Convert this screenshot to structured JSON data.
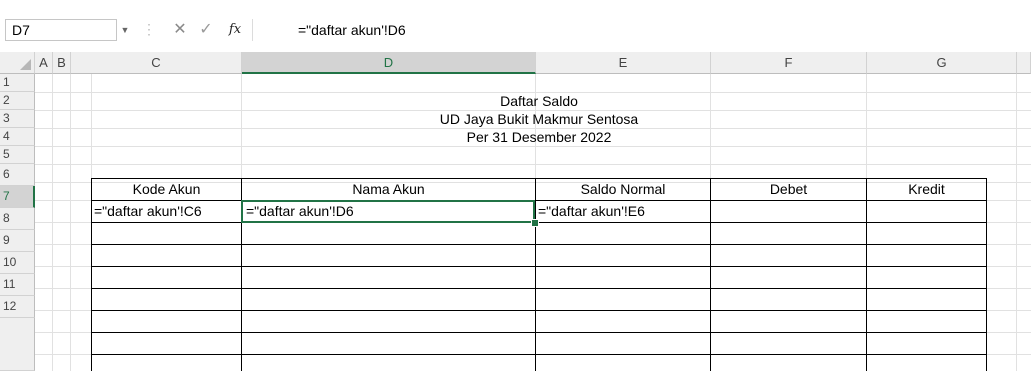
{
  "formula_bar": {
    "name_box": "D7",
    "name_box_arrow": "▼",
    "separator": "⋮",
    "cancel_icon": "✕",
    "enter_icon": "✓",
    "fx_label": "fx",
    "formula": "=\"daftar akun'!D6"
  },
  "columns": [
    "A",
    "B",
    "C",
    "D",
    "E",
    "F",
    "G"
  ],
  "rows": [
    "1",
    "2",
    "3",
    "4",
    "5",
    "6",
    "7",
    "8",
    "9",
    "10",
    "11",
    "12"
  ],
  "sheet": {
    "title1": "Daftar Saldo",
    "title2": "UD Jaya Bukit Makmur Sentosa",
    "title3": "Per 31 Desember 2022",
    "headers": [
      "Kode Akun",
      "Nama Akun",
      "Saldo Normal",
      "Debet",
      "Kredit"
    ],
    "row7": {
      "C": "=\"daftar akun'!C6",
      "D": "=\"daftar akun'!D6",
      "E": "=\"daftar akun'!E6"
    }
  },
  "selection": {
    "active_cell": "D7",
    "active_column": "D",
    "active_row": "7"
  },
  "colors": {
    "accent": "#217346",
    "header_bg": "#efefef",
    "gridline": "#e1e1e1"
  }
}
